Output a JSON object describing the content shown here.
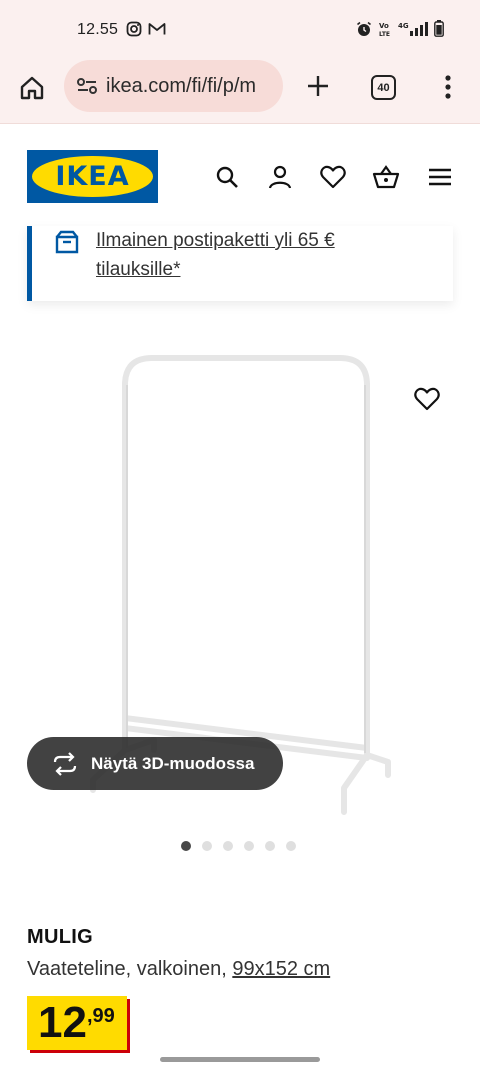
{
  "status_bar": {
    "time": "12.55",
    "left_icons": [
      "instagram-icon",
      "gmail-icon"
    ],
    "right_icons": [
      "alarm-icon",
      "volte-icon",
      "signal-icon",
      "battery-icon"
    ],
    "network": "4G"
  },
  "browser": {
    "url": "ikea.com/fi/fi/p/m",
    "tab_count": "40"
  },
  "header": {
    "logo_text": "IKEA",
    "brand_blue": "#0058a3",
    "brand_yellow": "#ffdb00",
    "icons": [
      "search-icon",
      "account-icon",
      "heart-icon",
      "basket-icon",
      "hamburger-icon"
    ]
  },
  "banner": {
    "text": "Ilmainen postipaketti yli 65 € tilauksille*"
  },
  "gallery": {
    "view3d_label": "Näytä 3D-muodossa",
    "image_count": 6,
    "active_index": 0
  },
  "product": {
    "name": "MULIG",
    "description": "Vaateteline, valkoinen,",
    "size": "99x152 cm",
    "price_integer": "12",
    "price_decimal": ",99",
    "price_bg": "#ffdb00",
    "price_accent": "#cc0008"
  }
}
